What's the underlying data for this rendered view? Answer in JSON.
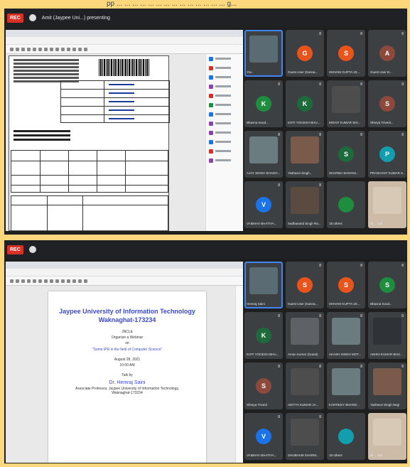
{
  "top_banner_text": "pp ... ... ... ... ... ... ... ... ... ... ... ... ... ... g...",
  "screenshot_1": {
    "recording_badge": "REC",
    "meeting_title": "Amit (Jaypee Uni...) presenting",
    "tiles": [
      {
        "name": "You",
        "initial": "",
        "color": "#5a6b73",
        "video": true,
        "light": false,
        "pinned": true,
        "number": ""
      },
      {
        "name": "Guest User (Kanna...",
        "initial": "G",
        "color": "#e8541b",
        "video": false,
        "light": false,
        "pinned": false,
        "number": "8"
      },
      {
        "name": "SHIVAM GUPTA 20...",
        "initial": "S",
        "color": "#e8541b",
        "video": false,
        "light": false,
        "pinned": false,
        "number": "8"
      },
      {
        "name": "Guest User B...",
        "initial": "A",
        "color": "#8d4a3c",
        "video": false,
        "light": false,
        "pinned": false,
        "number": "8"
      },
      {
        "name": "Bhavna Sood...",
        "initial": "K",
        "color": "#1e8e3e",
        "video": false,
        "light": false,
        "pinned": false,
        "number": "8"
      },
      {
        "name": "KOTI YOGESH BHU...",
        "initial": "K",
        "color": "#1d6b3a",
        "video": false,
        "light": false,
        "pinned": false,
        "number": "8"
      },
      {
        "name": "MOHIT KUMAR SIN...",
        "initial": "",
        "color": "#4d4d4d",
        "video": true,
        "light": false,
        "pinned": false,
        "number": "8"
      },
      {
        "name": "Shreya Trivedi...",
        "initial": "S",
        "color": "#8d4a3c",
        "video": false,
        "light": false,
        "pinned": false,
        "number": "8"
      },
      {
        "name": "AJAY SINGH BHADO...",
        "initial": "",
        "color": "#6b7c80",
        "video": true,
        "light": false,
        "pinned": false,
        "number": "8"
      },
      {
        "name": "Yashasvi Singh...",
        "initial": "",
        "color": "#7a5a4a",
        "video": true,
        "light": false,
        "pinned": false,
        "number": "8"
      },
      {
        "name": "SHARMA SHIVANI...",
        "initial": "S",
        "color": "#1d6b3a",
        "video": false,
        "light": false,
        "pinned": false,
        "number": "8"
      },
      {
        "name": "PRASHANT KUMAR S...",
        "initial": "P",
        "color": "#129eaf",
        "video": false,
        "light": false,
        "pinned": false,
        "number": "8"
      },
      {
        "name": "VAIBHAV BHATIYA...",
        "initial": "V",
        "color": "#1a73e8",
        "video": false,
        "light": false,
        "pinned": false,
        "number": "8"
      },
      {
        "name": "Sadhanand Singh Ra...",
        "initial": "",
        "color": "#5b4a3f",
        "video": true,
        "light": false,
        "pinned": false,
        "number": "8"
      },
      {
        "name": "18 others",
        "initial": "",
        "color": "#1e8e3e",
        "video": false,
        "light": false,
        "pinned": false,
        "number": ""
      },
      {
        "name": "Dr. ...ndi",
        "initial": "",
        "color": "#d8c9b6",
        "video": true,
        "light": true,
        "pinned": false,
        "number": ""
      }
    ]
  },
  "screenshot_2": {
    "recording_badge": "REC",
    "flyer": {
      "title": "Jaypee University of Information Technology Waknaghat-173234",
      "line1": "JNCLE",
      "line2": "Organize a Webinar",
      "line3": "on",
      "topic": "\"Some IPR in the field of Computer Science\"",
      "date": "August 28, 2021",
      "time": "10:00 AM",
      "talk_by": "Talk by",
      "speaker": "Dr. Hemraj Saini",
      "designation": "Associate Professor, Jaypee University of Information Technology, Waknaghat-173234"
    },
    "tiles": [
      {
        "name": "Hemraj Saini",
        "initial": "",
        "color": "#5a6b73",
        "video": true,
        "light": false,
        "pinned": true,
        "number": ""
      },
      {
        "name": "Guest User (Kanna...",
        "initial": "S",
        "color": "#e8541b",
        "video": false,
        "light": false,
        "pinned": false,
        "number": "8"
      },
      {
        "name": "SHIVAM GUPTA 20...",
        "initial": "S",
        "color": "#e8541b",
        "video": false,
        "light": false,
        "pinned": false,
        "number": "8"
      },
      {
        "name": "Bhavna Sood...",
        "initial": "S",
        "color": "#1e8e3e",
        "video": false,
        "light": false,
        "pinned": false,
        "number": "8"
      },
      {
        "name": "KOTI YOGESH BHU...",
        "initial": "K",
        "color": "#1d6b3a",
        "video": false,
        "light": false,
        "pinned": false,
        "number": "8"
      },
      {
        "name": "Aman Kumar (Guest)",
        "initial": "",
        "color": "#5e6166",
        "video": true,
        "light": false,
        "pinned": false,
        "number": "8"
      },
      {
        "name": "AKASH SINGH MOT...",
        "initial": "",
        "color": "#6b7c80",
        "video": true,
        "light": false,
        "pinned": false,
        "number": "8"
      },
      {
        "name": "ANISH KUMAR BHU...",
        "initial": "",
        "color": "#2f3236",
        "video": true,
        "light": false,
        "pinned": false,
        "number": "8"
      },
      {
        "name": "Shreya Trivedi",
        "initial": "S",
        "color": "#8d4a3c",
        "video": false,
        "light": false,
        "pinned": false,
        "number": "8"
      },
      {
        "name": "ADITYA KUMAR JA...",
        "initial": "",
        "color": "#4d4d4d",
        "video": true,
        "light": false,
        "pinned": false,
        "number": "8"
      },
      {
        "name": "KARTIKEY BHARD...",
        "initial": "",
        "color": "#6b7c80",
        "video": true,
        "light": false,
        "pinned": false,
        "number": "8"
      },
      {
        "name": "Yashasvi Singh Negi",
        "initial": "",
        "color": "#7a5a4a",
        "video": true,
        "light": false,
        "pinned": false,
        "number": "8"
      },
      {
        "name": "VAIBHAV BHATIYA...",
        "initial": "V",
        "color": "#1a73e8",
        "video": false,
        "light": false,
        "pinned": false,
        "number": "8"
      },
      {
        "name": "SHUBHAM SHARM...",
        "initial": "",
        "color": "#4d4d4d",
        "video": true,
        "light": false,
        "pinned": false,
        "number": "8"
      },
      {
        "name": "18 others",
        "initial": "",
        "color": "#129eaf",
        "video": false,
        "light": false,
        "pinned": false,
        "number": ""
      },
      {
        "name": "Dr. ...ndi",
        "initial": "",
        "color": "#d8c9b6",
        "video": true,
        "light": true,
        "pinned": false,
        "number": ""
      }
    ]
  }
}
